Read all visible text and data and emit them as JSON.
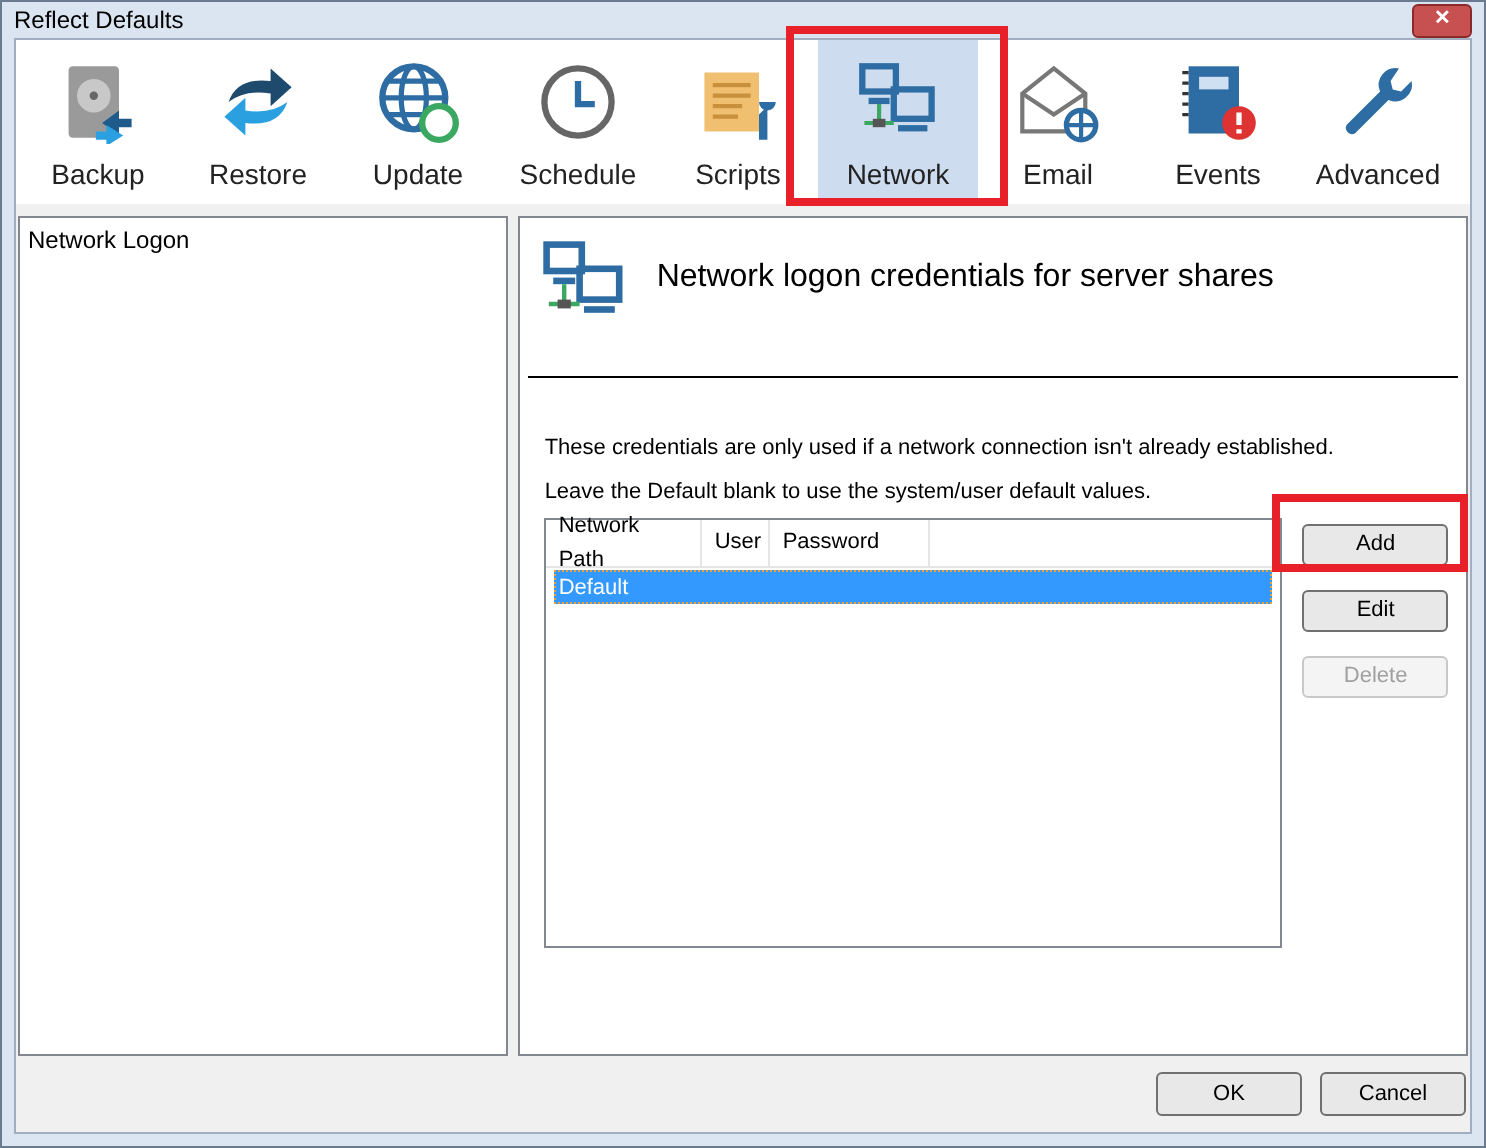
{
  "window": {
    "title": "Reflect Defaults",
    "close_label": "✕"
  },
  "toolbar": [
    {
      "label": "Backup",
      "kind": "disk",
      "selected": false,
      "highlighted": false
    },
    {
      "label": "Restore",
      "kind": "restore",
      "selected": false,
      "highlighted": false
    },
    {
      "label": "Update",
      "kind": "globe",
      "selected": false,
      "highlighted": false
    },
    {
      "label": "Schedule",
      "kind": "clock",
      "selected": false,
      "highlighted": false
    },
    {
      "label": "Scripts",
      "kind": "scroll",
      "selected": false,
      "highlighted": false
    },
    {
      "label": "Network",
      "kind": "network",
      "selected": true,
      "highlighted": true
    },
    {
      "label": "Email",
      "kind": "mail",
      "selected": false,
      "highlighted": false
    },
    {
      "label": "Events",
      "kind": "events",
      "selected": false,
      "highlighted": false
    },
    {
      "label": "Advanced",
      "kind": "wrench",
      "selected": false,
      "highlighted": false
    }
  ],
  "sidebar": {
    "items": [
      {
        "label": "Network Logon",
        "selected": false
      }
    ]
  },
  "panel": {
    "title": "Network logon credentials for server shares",
    "notes": [
      "These credentials are only used if a network connection isn't already established.",
      "Leave the Default blank to use the system/user default values."
    ],
    "table": {
      "columns": [
        "Network Path",
        "User",
        "Password"
      ],
      "rows": [
        {
          "cells": [
            "Default"
          ],
          "selected": true
        }
      ]
    },
    "buttons": [
      {
        "label": "Add",
        "disabled": false,
        "highlighted": true
      },
      {
        "label": "Edit",
        "disabled": false,
        "highlighted": false
      },
      {
        "label": "Delete",
        "disabled": true,
        "highlighted": false
      }
    ]
  },
  "footer_buttons": [
    "OK",
    "Cancel"
  ]
}
